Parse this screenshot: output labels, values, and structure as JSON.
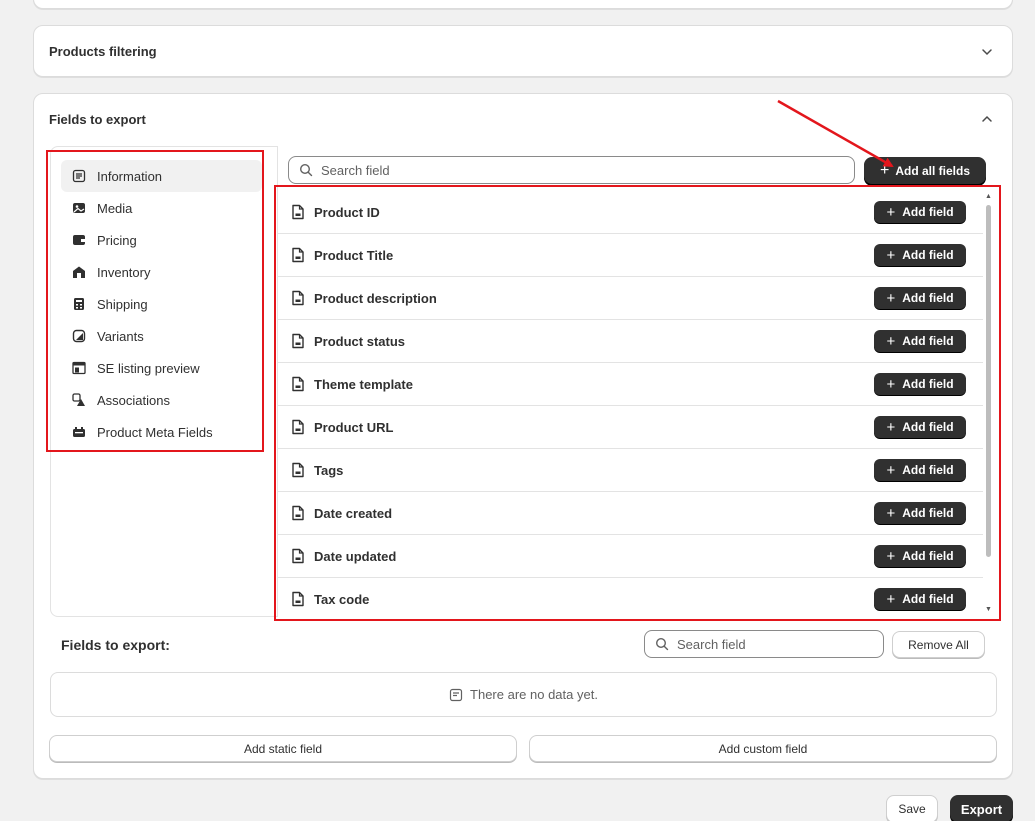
{
  "filter_section": {
    "title": "Products filtering"
  },
  "export_section": {
    "title": "Fields to export",
    "categories": [
      {
        "label": "Information",
        "icon": "list-icon"
      },
      {
        "label": "Media",
        "icon": "image-icon"
      },
      {
        "label": "Pricing",
        "icon": "wallet-icon"
      },
      {
        "label": "Inventory",
        "icon": "warehouse-icon"
      },
      {
        "label": "Shipping",
        "icon": "calculator-icon"
      },
      {
        "label": "Variants",
        "icon": "variant-icon"
      },
      {
        "label": "SE listing preview",
        "icon": "preview-icon"
      },
      {
        "label": "Associations",
        "icon": "associations-icon"
      },
      {
        "label": "Product Meta Fields",
        "icon": "meta-icon"
      }
    ],
    "search": {
      "placeholder": "Search field"
    },
    "add_all_label": "Add all fields",
    "add_field_label": "Add field",
    "fields": [
      "Product ID",
      "Product Title",
      "Product description",
      "Product status",
      "Theme template",
      "Product URL",
      "Tags",
      "Date created",
      "Date updated",
      "Tax code"
    ]
  },
  "selected": {
    "label": "Fields to export:",
    "search_placeholder": "Search field",
    "remove_all_label": "Remove All",
    "empty_text": "There are no data yet.",
    "add_static_label": "Add static field",
    "add_custom_label": "Add custom field"
  },
  "footer": {
    "save_label": "Save",
    "export_label": "Export"
  },
  "colors": {
    "accent_red": "#e3161c",
    "dark_button": "#303030"
  }
}
